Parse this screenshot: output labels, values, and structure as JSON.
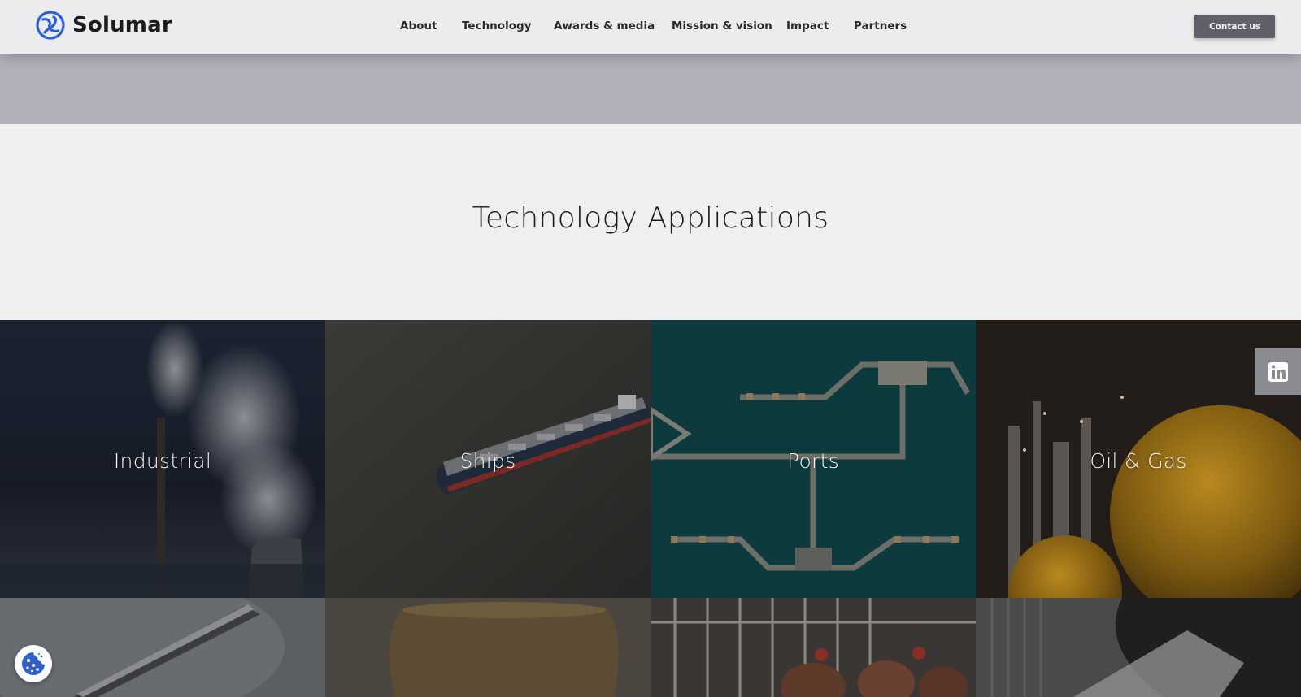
{
  "brand": {
    "name": "Solumar",
    "accent": "#2b5fd6"
  },
  "nav": {
    "items": [
      {
        "label": "About"
      },
      {
        "label": "Technology"
      },
      {
        "label": "Awards & media"
      },
      {
        "label": "Mission & vision"
      },
      {
        "label": "Impact"
      },
      {
        "label": "Partners"
      }
    ],
    "contact_label": "Contact us"
  },
  "section": {
    "title": "Technology Applications"
  },
  "applications": [
    {
      "label": "Industrial",
      "icon": "smokestack-image"
    },
    {
      "label": "Ships",
      "icon": "cargo-ship-image"
    },
    {
      "label": "Ports",
      "icon": "port-pier-image"
    },
    {
      "label": "Oil & Gas",
      "icon": "refinery-tank-image"
    },
    {
      "label": "",
      "icon": "conveyor-image"
    },
    {
      "label": "",
      "icon": "cooling-tower-image"
    },
    {
      "label": "",
      "icon": "poultry-farm-image"
    },
    {
      "label": "",
      "icon": "warehouse-image"
    }
  ],
  "social": {
    "icon": "linkedin-icon"
  },
  "cookie": {
    "icon": "cookie-icon"
  }
}
